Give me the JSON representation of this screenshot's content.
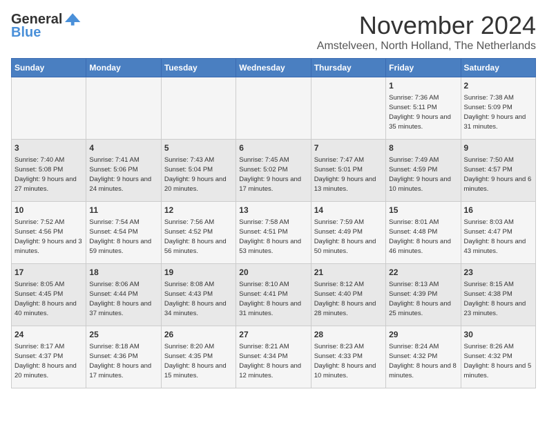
{
  "logo": {
    "general": "General",
    "blue": "Blue"
  },
  "header": {
    "title": "November 2024",
    "subtitle": "Amstelveen, North Holland, The Netherlands"
  },
  "weekdays": [
    "Sunday",
    "Monday",
    "Tuesday",
    "Wednesday",
    "Thursday",
    "Friday",
    "Saturday"
  ],
  "weeks": [
    [
      {
        "day": "",
        "info": ""
      },
      {
        "day": "",
        "info": ""
      },
      {
        "day": "",
        "info": ""
      },
      {
        "day": "",
        "info": ""
      },
      {
        "day": "",
        "info": ""
      },
      {
        "day": "1",
        "info": "Sunrise: 7:36 AM\nSunset: 5:11 PM\nDaylight: 9 hours and 35 minutes."
      },
      {
        "day": "2",
        "info": "Sunrise: 7:38 AM\nSunset: 5:09 PM\nDaylight: 9 hours and 31 minutes."
      }
    ],
    [
      {
        "day": "3",
        "info": "Sunrise: 7:40 AM\nSunset: 5:08 PM\nDaylight: 9 hours and 27 minutes."
      },
      {
        "day": "4",
        "info": "Sunrise: 7:41 AM\nSunset: 5:06 PM\nDaylight: 9 hours and 24 minutes."
      },
      {
        "day": "5",
        "info": "Sunrise: 7:43 AM\nSunset: 5:04 PM\nDaylight: 9 hours and 20 minutes."
      },
      {
        "day": "6",
        "info": "Sunrise: 7:45 AM\nSunset: 5:02 PM\nDaylight: 9 hours and 17 minutes."
      },
      {
        "day": "7",
        "info": "Sunrise: 7:47 AM\nSunset: 5:01 PM\nDaylight: 9 hours and 13 minutes."
      },
      {
        "day": "8",
        "info": "Sunrise: 7:49 AM\nSunset: 4:59 PM\nDaylight: 9 hours and 10 minutes."
      },
      {
        "day": "9",
        "info": "Sunrise: 7:50 AM\nSunset: 4:57 PM\nDaylight: 9 hours and 6 minutes."
      }
    ],
    [
      {
        "day": "10",
        "info": "Sunrise: 7:52 AM\nSunset: 4:56 PM\nDaylight: 9 hours and 3 minutes."
      },
      {
        "day": "11",
        "info": "Sunrise: 7:54 AM\nSunset: 4:54 PM\nDaylight: 8 hours and 59 minutes."
      },
      {
        "day": "12",
        "info": "Sunrise: 7:56 AM\nSunset: 4:52 PM\nDaylight: 8 hours and 56 minutes."
      },
      {
        "day": "13",
        "info": "Sunrise: 7:58 AM\nSunset: 4:51 PM\nDaylight: 8 hours and 53 minutes."
      },
      {
        "day": "14",
        "info": "Sunrise: 7:59 AM\nSunset: 4:49 PM\nDaylight: 8 hours and 50 minutes."
      },
      {
        "day": "15",
        "info": "Sunrise: 8:01 AM\nSunset: 4:48 PM\nDaylight: 8 hours and 46 minutes."
      },
      {
        "day": "16",
        "info": "Sunrise: 8:03 AM\nSunset: 4:47 PM\nDaylight: 8 hours and 43 minutes."
      }
    ],
    [
      {
        "day": "17",
        "info": "Sunrise: 8:05 AM\nSunset: 4:45 PM\nDaylight: 8 hours and 40 minutes."
      },
      {
        "day": "18",
        "info": "Sunrise: 8:06 AM\nSunset: 4:44 PM\nDaylight: 8 hours and 37 minutes."
      },
      {
        "day": "19",
        "info": "Sunrise: 8:08 AM\nSunset: 4:43 PM\nDaylight: 8 hours and 34 minutes."
      },
      {
        "day": "20",
        "info": "Sunrise: 8:10 AM\nSunset: 4:41 PM\nDaylight: 8 hours and 31 minutes."
      },
      {
        "day": "21",
        "info": "Sunrise: 8:12 AM\nSunset: 4:40 PM\nDaylight: 8 hours and 28 minutes."
      },
      {
        "day": "22",
        "info": "Sunrise: 8:13 AM\nSunset: 4:39 PM\nDaylight: 8 hours and 25 minutes."
      },
      {
        "day": "23",
        "info": "Sunrise: 8:15 AM\nSunset: 4:38 PM\nDaylight: 8 hours and 23 minutes."
      }
    ],
    [
      {
        "day": "24",
        "info": "Sunrise: 8:17 AM\nSunset: 4:37 PM\nDaylight: 8 hours and 20 minutes."
      },
      {
        "day": "25",
        "info": "Sunrise: 8:18 AM\nSunset: 4:36 PM\nDaylight: 8 hours and 17 minutes."
      },
      {
        "day": "26",
        "info": "Sunrise: 8:20 AM\nSunset: 4:35 PM\nDaylight: 8 hours and 15 minutes."
      },
      {
        "day": "27",
        "info": "Sunrise: 8:21 AM\nSunset: 4:34 PM\nDaylight: 8 hours and 12 minutes."
      },
      {
        "day": "28",
        "info": "Sunrise: 8:23 AM\nSunset: 4:33 PM\nDaylight: 8 hours and 10 minutes."
      },
      {
        "day": "29",
        "info": "Sunrise: 8:24 AM\nSunset: 4:32 PM\nDaylight: 8 hours and 8 minutes."
      },
      {
        "day": "30",
        "info": "Sunrise: 8:26 AM\nSunset: 4:32 PM\nDaylight: 8 hours and 5 minutes."
      }
    ]
  ]
}
